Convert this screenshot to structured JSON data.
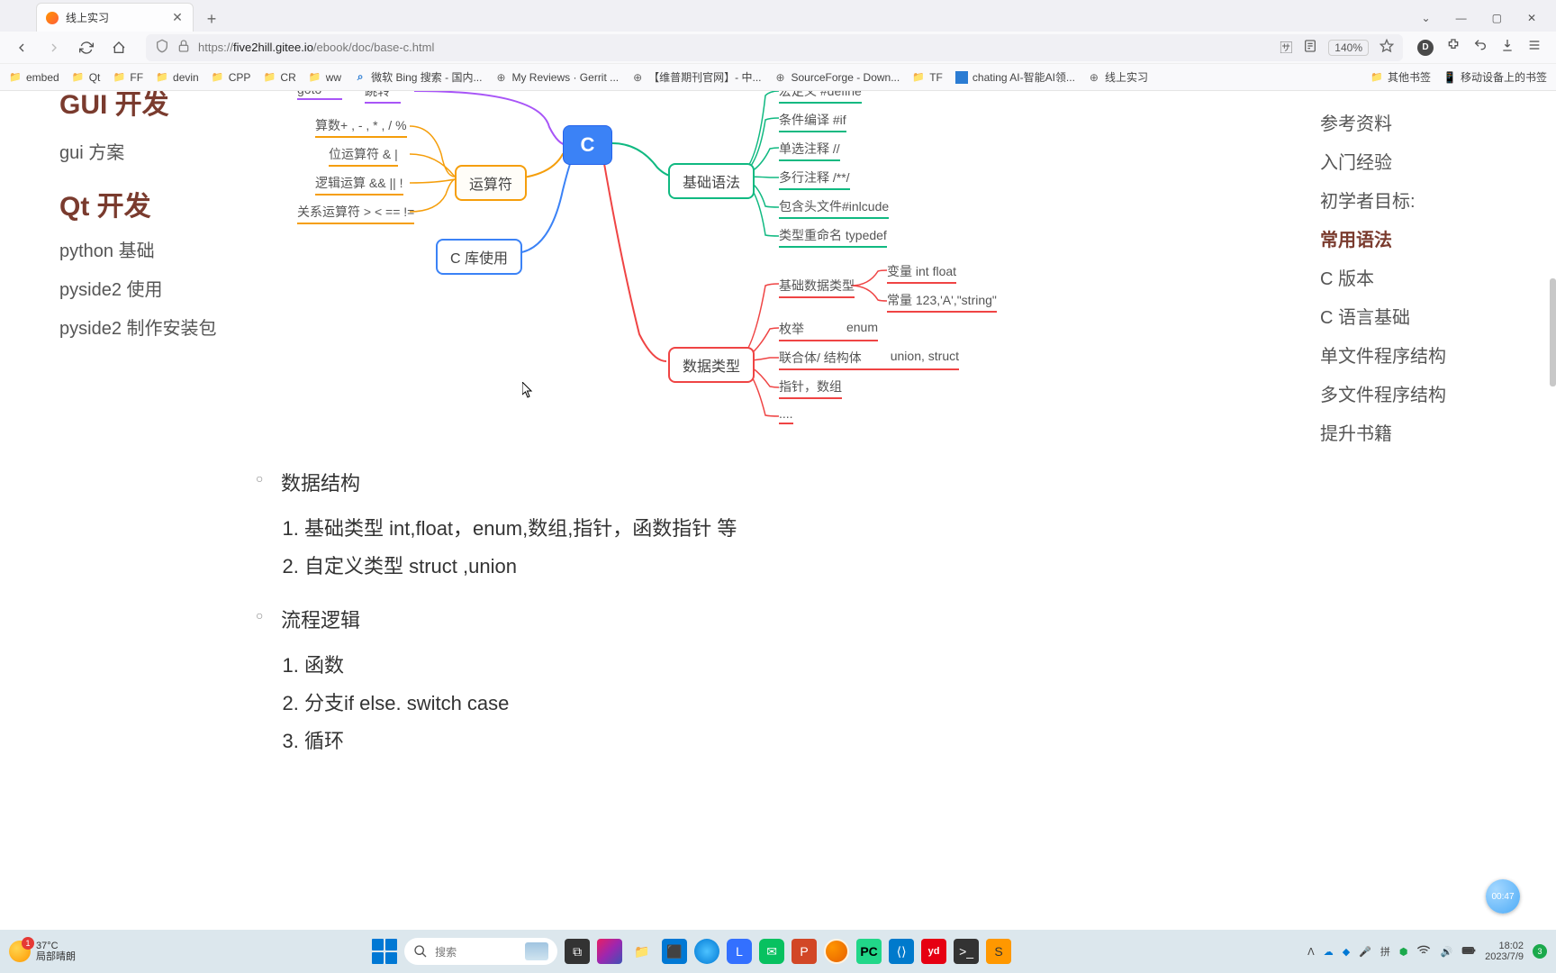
{
  "window": {
    "tab_title": "线上实习",
    "chevron": "⌄",
    "minimize": "—",
    "maximize": "▢",
    "close": "✕",
    "newtab": "+"
  },
  "toolbar": {
    "url_prefix": "https://",
    "url_host": "five2hill.gitee.io",
    "url_path": "/ebook/doc/base-c.html",
    "zoom": "140%",
    "account_letter": "D"
  },
  "bookmarks": [
    {
      "type": "folder",
      "label": "embed"
    },
    {
      "type": "folder",
      "label": "Qt"
    },
    {
      "type": "folder",
      "label": "FF"
    },
    {
      "type": "folder",
      "label": "devin"
    },
    {
      "type": "folder",
      "label": "CPP"
    },
    {
      "type": "folder",
      "label": "CR"
    },
    {
      "type": "folder",
      "label": "ww"
    },
    {
      "type": "search",
      "label": "微软 Bing 搜索 - 国内..."
    },
    {
      "type": "globe",
      "label": "My Reviews · Gerrit ..."
    },
    {
      "type": "globe",
      "label": "【维普期刊官网】- 中..."
    },
    {
      "type": "globe",
      "label": "SourceForge - Down..."
    },
    {
      "type": "folder",
      "label": "TF"
    },
    {
      "type": "square",
      "label": "chating AI-智能AI领..."
    },
    {
      "type": "globe",
      "label": "线上实习"
    }
  ],
  "bookmarks_right": [
    {
      "type": "folder",
      "label": "其他书签"
    },
    {
      "type": "mobile",
      "label": "移动设备上的书签"
    }
  ],
  "leftnav": {
    "h1": "GUI 开发",
    "items1": [
      "gui 方案"
    ],
    "h2": "Qt 开发",
    "items2": [
      "python 基础",
      "pyside2 使用",
      "pyside2 制作安装包"
    ]
  },
  "righttoc": {
    "items": [
      {
        "label": "参考资料",
        "active": false
      },
      {
        "label": "入门经验",
        "active": false
      },
      {
        "label": "初学者目标:",
        "active": false
      },
      {
        "label": "常用语法",
        "active": true
      },
      {
        "label": "C 版本",
        "active": false
      },
      {
        "label": "C 语言基础",
        "active": false
      },
      {
        "label": "单文件程序结构",
        "active": false
      },
      {
        "label": "多文件程序结构",
        "active": false
      },
      {
        "label": "提升书籍",
        "active": false
      }
    ]
  },
  "mindmap": {
    "center": "C",
    "purple_leaves": {
      "goto": "goto",
      "jump": "跳转"
    },
    "orange_node": "运算符",
    "orange_leaves": [
      "算数+ , - , * , / %",
      "位运算符 & |",
      "逻辑运算 && || !",
      "关系运算符 > < == !="
    ],
    "blue_node": "C 库使用",
    "green_node": "基础语法",
    "green_leaves": [
      "宏定义  #define",
      "条件编译  #if",
      "单选注释 //",
      "多行注释 /**/",
      "包含头文件#inlcude",
      "类型重命名 typedef"
    ],
    "red_node": "数据类型",
    "red_group1": "基础数据类型",
    "red_group1_leaves": [
      "变量 int float",
      "常量 123,'A',\"string\""
    ],
    "red_leaves": [
      {
        "l": "枚举",
        "r": "enum"
      },
      {
        "l": "联合体/ 结构体",
        "r": "union,  struct"
      },
      {
        "l": "指针，数组",
        "r": ""
      },
      {
        "l": "....",
        "r": ""
      }
    ]
  },
  "article": {
    "bullet1": "数据结构",
    "list1": [
      "基础类型 int,float，enum,数组,指针，函数指针 等",
      "自定义类型 struct ,union"
    ],
    "bullet2": "流程逻辑",
    "list2": [
      "函数",
      "分支if else. switch case",
      "循环"
    ]
  },
  "floatbadge": "00:47",
  "taskbar": {
    "weather_temp": "37°C",
    "weather_desc": "局部晴朗",
    "weather_badge": "1",
    "search_placeholder": "搜索",
    "time": "18:02",
    "date": "2023/7/9",
    "notif": "3"
  }
}
